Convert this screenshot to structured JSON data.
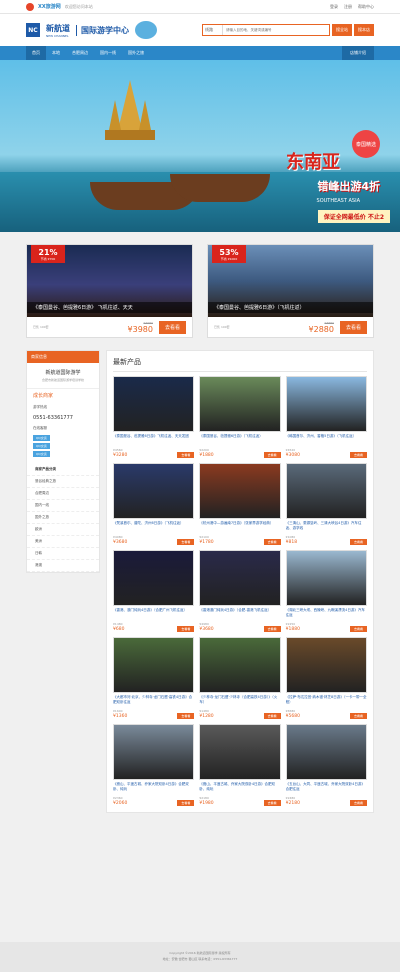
{
  "topbar": {
    "brand": "XX旅游网",
    "welcome": "欢迎您访问本站",
    "login": "登录",
    "register": "注册",
    "help": "帮助中心"
  },
  "header": {
    "logo": "NC",
    "brand_cn": "新航道",
    "brand_en": "NEW CHANNEL",
    "center": "国际游学中心",
    "search_type": "线路",
    "search_placeholder": "请输入目的地、关键词或编号",
    "search_button": "搜全站",
    "search_button2": "搜本店"
  },
  "nav": {
    "items": [
      "首页",
      "本地",
      "合肥周边",
      "国内一线",
      "国外之旅"
    ],
    "right": "店铺介绍"
  },
  "banner": {
    "title": "东南亚",
    "subtitle": "错峰出游4折",
    "sub_en": "SOUTHEAST ASIA",
    "slogan": "保证全网最低价 不止2",
    "badge": "泰国精选"
  },
  "deals": [
    {
      "discount": "21%",
      "save": "节省 ¥700",
      "caption": "《泰国曼谷、芭提雅6日游》 飞机往返、天天",
      "old": "¥4680",
      "price": "3980",
      "sold": "已售 100套",
      "btn": "去看看"
    },
    {
      "discount": "53%",
      "save": "节省 ¥1000",
      "caption": "《泰国曼谷、芭提雅6日游》（飞机往返）",
      "old": "¥3880",
      "price": "2880",
      "sold": "已售 100套",
      "btn": "去看看"
    }
  ],
  "sidebar": {
    "header": "商家信息",
    "shop_name": "新航道国际游学",
    "shop_desc": "合肥市新航道国际游学培训学校",
    "level_label": "成长商家",
    "phone_label": "游学热线",
    "phone": "0551-63361777",
    "online_label": "在线客服",
    "qq": [
      "QQ交谈",
      "QQ交谈",
      "QQ交谈"
    ],
    "cat_header": "商家产品分类",
    "cats": [
      "曼谷经典之旅",
      "合肥周边",
      "国内一线",
      "国外之旅",
      "欧洲",
      "美洲",
      "日韩",
      "港澳"
    ]
  },
  "content": {
    "header": "最新产品",
    "products": [
      {
        "title": "《泰国曼谷、芭提雅6日游》飞机往返、天天发团",
        "old": "¥4560",
        "price": "3280",
        "btn": "去看看"
      },
      {
        "title": "《泰国曼谷、芭提雅6日游》（飞机往返）",
        "old": "¥2200",
        "price": "1880",
        "btn": "去看看"
      },
      {
        "title": "《韩国首尔、济州、香格5日游》（飞机往返）",
        "old": "¥4520",
        "price": "3080",
        "btn": "去看看"
      },
      {
        "title": "《梵溪首尔、普陀、济州6日游》（飞机往返）",
        "old": "¥4080",
        "price": "3680",
        "btn": "去看看"
      },
      {
        "title": "《杭州港中—游遍南7日游》（张家界游学经典）",
        "old": "¥2100",
        "price": "1780",
        "btn": "去看看"
      },
      {
        "title": "《三清山、婺源篁岭、三清大峡谷4日游》汽车往返、游学线",
        "old": "¥1080",
        "price": "818",
        "btn": "去看看"
      },
      {
        "title": "《香港、澳门纯玩4日游》（合肥广州飞机往返）",
        "old": "¥1480",
        "price": "680",
        "btn": "去看看"
      },
      {
        "title": "《香港澳门纯玩4日游》（合肥-香港飞机往返）",
        "old": "¥4980",
        "price": "3680",
        "btn": "去看看"
      },
      {
        "title": "《湖北三峡大坝、西陵峡、九畹溪漂流4日游》汽车往返",
        "old": "¥2250",
        "price": "1880",
        "btn": "去看看"
      },
      {
        "title": "《大都市河·北京、少林寺·龙门石窟·高铁4日游》合肥双卧往返",
        "old": "¥1600",
        "price": "1360",
        "btn": "去看看"
      },
      {
        "title": "《少林寺·龙门石窟·少林寺（合肥高铁4日游）》（火车）",
        "old": "¥1480",
        "price": "1280",
        "btn": "去看看"
      },
      {
        "title": "《拉萨·布达拉宫·纳木错·林芝8日游》（一卡一带一全程）",
        "old": "¥6580",
        "price": "5680",
        "btn": "去看看"
      },
      {
        "title": "《嵩山、平遥古城、乔家大院双卧4日游》合肥双卧、纯玩",
        "old": "¥2360",
        "price": "2060",
        "btn": "去看看"
      },
      {
        "title": "《嵩山、平遥古城、乔家大院双卧4日游》合肥双卧、纯玩",
        "old": "¥2180",
        "price": "1980",
        "btn": "去看看"
      },
      {
        "title": "《五台山、大同、平遥古城、乔家大院双卧4日游》合肥往返",
        "old": "¥2480",
        "price": "2180",
        "btn": "去看看"
      }
    ]
  },
  "footer": {
    "line1": "Copyright ©2016 新航道国际游学 版权所有",
    "line2": "地址：安徽 合肥市 蜀山区 联系电话：0551-63361777"
  }
}
